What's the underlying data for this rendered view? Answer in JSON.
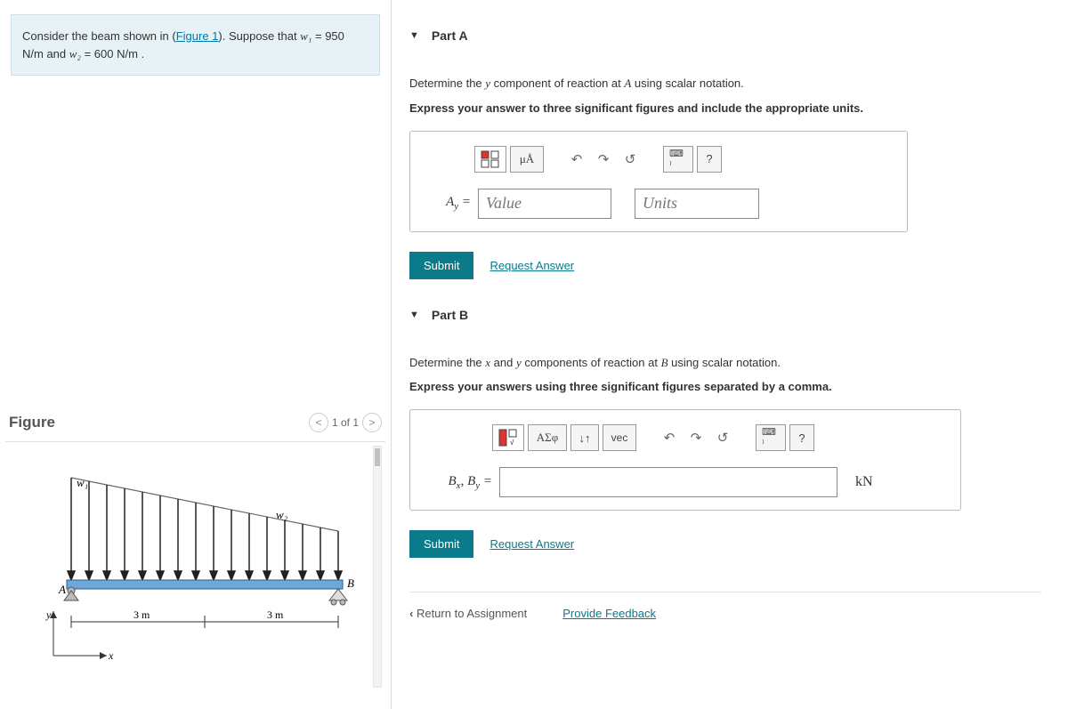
{
  "problem": {
    "intro_a": "Consider the beam shown in (",
    "fig_link": "Figure 1",
    "intro_b": "). Suppose that ",
    "w1_var": "w₁",
    "w1_val": " = 950  N/m",
    "and": " and ",
    "w2_var": "w₂",
    "w2_val": " = 600  N/m ."
  },
  "figure": {
    "title": "Figure",
    "pager": "1 of 1",
    "labels": {
      "w1": "w₁",
      "w2": "w₂",
      "A": "A",
      "B": "B",
      "d1": "3 m",
      "d2": "3 m",
      "x": "x",
      "y": "y"
    }
  },
  "partA": {
    "title": "Part A",
    "instr": "Determine the ",
    "yvar": "y",
    "instr2": " component of reaction at ",
    "Avar": "A",
    "instr3": " using scalar notation.",
    "bold": "Express your answer to three significant figures and include the appropriate units.",
    "label_html": "A_y =",
    "value_ph": "Value",
    "units_ph": "Units",
    "toolbar": {
      "mua": "μÅ",
      "undo": "↶",
      "redo": "↷",
      "reset": "↺",
      "kbd": "⌨ ⁾",
      "help": "?"
    },
    "submit": "Submit",
    "request": "Request Answer"
  },
  "partB": {
    "title": "Part B",
    "instr": "Determine the ",
    "xvar": "x",
    "and": " and ",
    "yvar": "y",
    "instr2": " components of reaction at ",
    "Bvar": "B",
    "instr3": " using scalar notation.",
    "bold": "Express your answers using three significant figures separated by a comma.",
    "label_html": "B_x, B_y =",
    "unit": "kN",
    "toolbar": {
      "asph": "ΑΣφ",
      "updown": "↓↑",
      "vec": "vec",
      "undo": "↶",
      "redo": "↷",
      "reset": "↺",
      "kbd": "⌨ ⁾",
      "help": "?"
    },
    "submit": "Submit",
    "request": "Request Answer"
  },
  "footer": {
    "return": "Return to Assignment",
    "feedback": "Provide Feedback"
  }
}
